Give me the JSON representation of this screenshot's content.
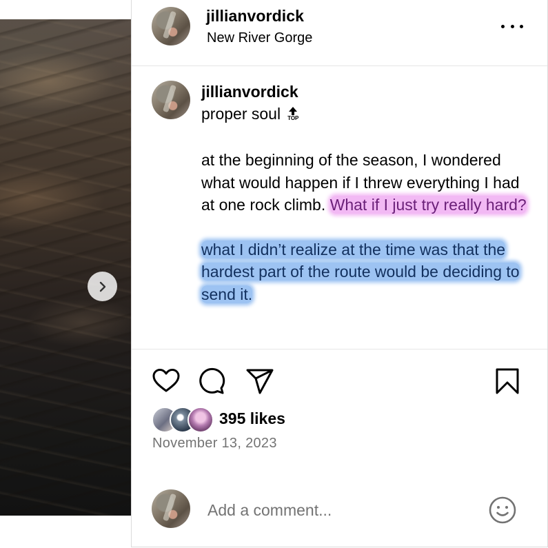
{
  "post": {
    "username": "jillianvordick",
    "location": "New River Gorge"
  },
  "caption": {
    "username": "jillianvordick",
    "title": "proper soul",
    "title_emoji": {
      "icon": "top-arrow-emoji",
      "label": "TOP"
    },
    "paragraph1_plain": "at the beginning of the season, I wondered what would happen if I threw everything I had at one rock climb. ",
    "paragraph1_highlight": "What if I just try really hard?",
    "paragraph2_highlight": "what I didn’t realize at the time was that the hardest part of the route would be deciding to send it."
  },
  "highlights": {
    "pink": "#f2b9f4",
    "blue": "#9dc3f2"
  },
  "actions": {
    "icons": [
      "heart-icon",
      "comment-icon",
      "share-icon",
      "bookmark-icon"
    ]
  },
  "engagement": {
    "likes": "395 likes",
    "date": "November 13, 2023"
  },
  "comment_box": {
    "placeholder": "Add a comment...",
    "emoji_icon": "smiley-icon"
  },
  "media": {
    "next_icon": "chevron-right-icon"
  }
}
